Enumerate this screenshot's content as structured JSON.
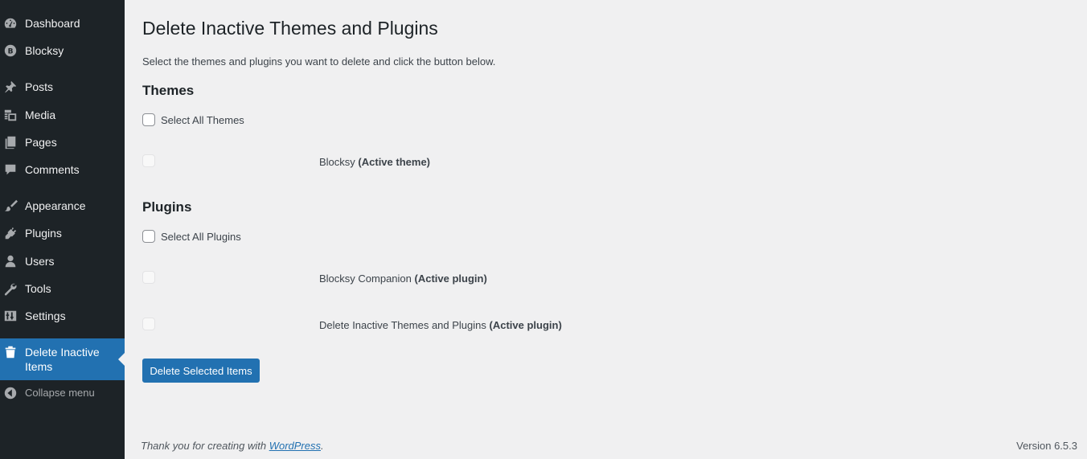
{
  "sidebar": {
    "items": [
      {
        "label": "Dashboard",
        "icon": "dashboard-icon"
      },
      {
        "label": "Blocksy",
        "icon": "blocksy-icon"
      },
      {
        "label": "Posts",
        "icon": "pushpin-icon"
      },
      {
        "label": "Media",
        "icon": "media-icon"
      },
      {
        "label": "Pages",
        "icon": "pages-icon"
      },
      {
        "label": "Comments",
        "icon": "comment-bubble-icon"
      },
      {
        "label": "Appearance",
        "icon": "paintbrush-icon"
      },
      {
        "label": "Plugins",
        "icon": "plug-icon"
      },
      {
        "label": "Users",
        "icon": "user-icon"
      },
      {
        "label": "Tools",
        "icon": "wrench-icon"
      },
      {
        "label": "Settings",
        "icon": "settings-sliders-icon"
      },
      {
        "label": "Delete Inactive Items",
        "icon": "trash-icon",
        "current": true
      },
      {
        "label": "Collapse menu",
        "icon": "collapse-arrow-icon"
      }
    ]
  },
  "main": {
    "title": "Delete Inactive Themes and Plugins",
    "intro": "Select the themes and plugins you want to delete and click the button below.",
    "themes": {
      "heading": "Themes",
      "select_all": "Select All Themes",
      "items": [
        {
          "name": "Blocksy",
          "status": "(Active theme)"
        }
      ]
    },
    "plugins": {
      "heading": "Plugins",
      "select_all": "Select All Plugins",
      "items": [
        {
          "name": "Blocksy Companion",
          "status": "(Active plugin)"
        },
        {
          "name": "Delete Inactive Themes and Plugins",
          "status": "(Active plugin)"
        }
      ]
    },
    "delete_button": "Delete Selected Items"
  },
  "footer": {
    "thanks_prefix": "Thank you for creating with",
    "thanks_link": "WordPress",
    "thanks_suffix": ".",
    "version": "Version 6.5.3"
  },
  "colors": {
    "sidebar_bg": "#1d2327",
    "accent": "#2271b1",
    "page_bg": "#f0f0f1"
  }
}
